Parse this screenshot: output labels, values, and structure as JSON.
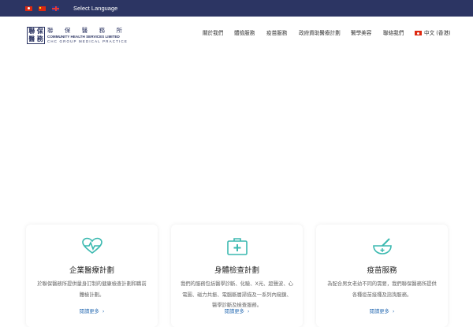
{
  "topbar": {
    "flags": [
      "hk-flag-icon",
      "cn-flag-icon",
      "uk-flag-icon"
    ],
    "select_language": "Select Language",
    "bg_color": "#2c3563"
  },
  "logo": {
    "mark_chars": [
      "聯",
      "保",
      "醫",
      "務"
    ],
    "cn_name": "聯 保 醫 務 所",
    "en_line1": "COMMUNITY HEALTH SERVICES LIMITED",
    "en_line2": "CHC GROUP MEDICAL PRACTICE"
  },
  "nav": {
    "items": [
      "關於我們",
      "體檢服務",
      "疫苗服務",
      "政府資助醫療計劃",
      "醫學美容",
      "聯絡我們"
    ],
    "lang": "中文 (香港)"
  },
  "cards": [
    {
      "icon": "heart-pulse-icon",
      "title": "企業醫療計劃",
      "desc": "於聯保醫務所提供量身訂制的健康檢查計劃和職前體檢計劃。",
      "more": "閱讀更多"
    },
    {
      "icon": "first-aid-kit-icon",
      "title": "身體檢查計劃",
      "desc": "我們的服務包括醫學診斷、化驗、X光、超聲波、心電圖、磁力共振、電腦斷層掃描及一系列內窺鏡、醫學診斷及檢查服務。",
      "more": "閱讀更多"
    },
    {
      "icon": "mortar-pestle-icon",
      "title": "疫苗服務",
      "desc": "為配合男女老幼不同的需要，我們聯保醫務所提供各種疫苗接種及諮詢服務。",
      "more": "閱讀更多"
    }
  ],
  "colors": {
    "brand_navy": "#2c3563",
    "icon_teal": "#3bb9b0",
    "link_blue": "#2d6fb5"
  }
}
